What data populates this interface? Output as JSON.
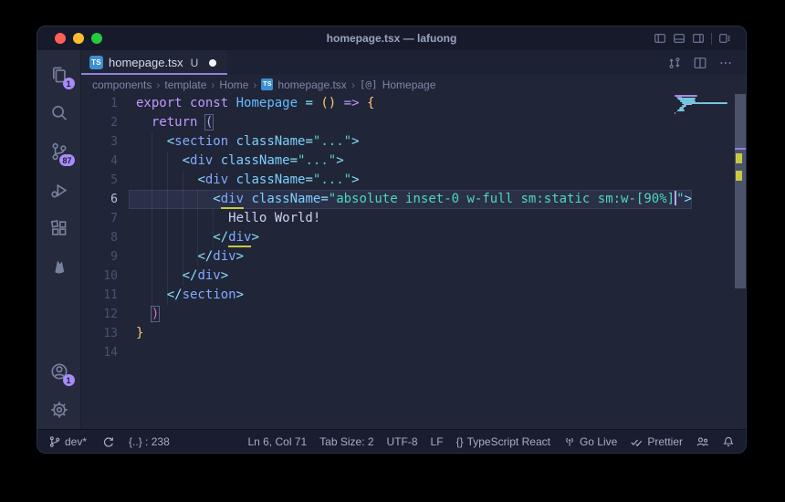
{
  "window": {
    "title": "homepage.tsx — lafuong"
  },
  "tab": {
    "file": "homepage.tsx",
    "git": "U",
    "ts_badge": "TS"
  },
  "breadcrumb": {
    "separator": "›",
    "symbol_glyph": "[@]",
    "items": [
      "components",
      "template",
      "Home",
      "homepage.tsx",
      "Homepage"
    ]
  },
  "activity_bar": {
    "explorer_badge": "1",
    "scm_badge": "87",
    "accounts_badge": "1"
  },
  "status_bar": {
    "branch": "dev*",
    "counter": "{..} : 238",
    "line_col": "Ln 6, Col 71",
    "tab_size": "Tab Size: 2",
    "encoding": "UTF-8",
    "eol": "LF",
    "language_icon": "{}",
    "language": "TypeScript React",
    "go_live": "Go Live",
    "prettier": "Prettier"
  },
  "code": {
    "lines": [
      {
        "n": 1,
        "tokens": [
          {
            "t": "export",
            "c": "kw"
          },
          {
            "t": " ",
            "c": "fg"
          },
          {
            "t": "const",
            "c": "kw"
          },
          {
            "t": " ",
            "c": "fg"
          },
          {
            "t": "Homepage",
            "c": "comp"
          },
          {
            "t": " ",
            "c": "fg"
          },
          {
            "t": "=",
            "c": "punct"
          },
          {
            "t": " ",
            "c": "fg"
          },
          {
            "t": "()",
            "c": "ybr"
          },
          {
            "t": " ",
            "c": "fg"
          },
          {
            "t": "=>",
            "c": "kw"
          },
          {
            "t": " ",
            "c": "fg"
          },
          {
            "t": "{",
            "c": "ybr"
          }
        ]
      },
      {
        "n": 2,
        "tokens": [
          {
            "t": "  ",
            "c": "fg"
          },
          {
            "t": "return",
            "c": "kw"
          },
          {
            "t": " ",
            "c": "fg"
          },
          {
            "t": "(",
            "c": "lav",
            "box": true
          }
        ]
      },
      {
        "n": 3,
        "tokens": [
          {
            "t": "    ",
            "c": "fg"
          },
          {
            "t": "<",
            "c": "punct"
          },
          {
            "t": "section",
            "c": "tag"
          },
          {
            "t": " ",
            "c": "fg"
          },
          {
            "t": "className",
            "c": "attr"
          },
          {
            "t": "=",
            "c": "punct"
          },
          {
            "t": "\"...\"",
            "c": "str"
          },
          {
            "t": ">",
            "c": "punct"
          }
        ]
      },
      {
        "n": 4,
        "tokens": [
          {
            "t": "      ",
            "c": "fg"
          },
          {
            "t": "<",
            "c": "punct"
          },
          {
            "t": "div",
            "c": "tag"
          },
          {
            "t": " ",
            "c": "fg"
          },
          {
            "t": "className",
            "c": "attr"
          },
          {
            "t": "=",
            "c": "punct"
          },
          {
            "t": "\"...\"",
            "c": "str"
          },
          {
            "t": ">",
            "c": "punct"
          }
        ]
      },
      {
        "n": 5,
        "tokens": [
          {
            "t": "        ",
            "c": "fg"
          },
          {
            "t": "<",
            "c": "punct"
          },
          {
            "t": "div",
            "c": "tag"
          },
          {
            "t": " ",
            "c": "fg"
          },
          {
            "t": "className",
            "c": "attr"
          },
          {
            "t": "=",
            "c": "punct"
          },
          {
            "t": "\"...\"",
            "c": "str"
          },
          {
            "t": ">",
            "c": "punct"
          }
        ]
      },
      {
        "n": 6,
        "current": true,
        "tokens": [
          {
            "t": "          ",
            "c": "fg"
          },
          {
            "t": "<",
            "c": "punct"
          },
          {
            "t": "div",
            "c": "tag",
            "u": true
          },
          {
            "t": " ",
            "c": "fg"
          },
          {
            "t": "className",
            "c": "attr"
          },
          {
            "t": "=",
            "c": "punct"
          },
          {
            "t": "\"absolute inset-0 w-full sm:static sm:w-[90%]",
            "c": "str"
          },
          {
            "t": "",
            "cursor": true
          },
          {
            "t": "\"",
            "c": "str"
          },
          {
            "t": ">",
            "c": "punct"
          }
        ]
      },
      {
        "n": 7,
        "tokens": [
          {
            "t": "            Hello World!",
            "c": "fg"
          }
        ]
      },
      {
        "n": 8,
        "tokens": [
          {
            "t": "          ",
            "c": "fg"
          },
          {
            "t": "</",
            "c": "punct"
          },
          {
            "t": "div",
            "c": "tag",
            "u": true
          },
          {
            "t": ">",
            "c": "punct"
          }
        ]
      },
      {
        "n": 9,
        "tokens": [
          {
            "t": "        ",
            "c": "fg"
          },
          {
            "t": "</",
            "c": "punct"
          },
          {
            "t": "div",
            "c": "tag"
          },
          {
            "t": ">",
            "c": "punct"
          }
        ]
      },
      {
        "n": 10,
        "tokens": [
          {
            "t": "      ",
            "c": "fg"
          },
          {
            "t": "</",
            "c": "punct"
          },
          {
            "t": "div",
            "c": "tag"
          },
          {
            "t": ">",
            "c": "punct"
          }
        ]
      },
      {
        "n": 11,
        "tokens": [
          {
            "t": "    ",
            "c": "fg"
          },
          {
            "t": "</",
            "c": "punct"
          },
          {
            "t": "section",
            "c": "tag"
          },
          {
            "t": ">",
            "c": "punct"
          }
        ]
      },
      {
        "n": 12,
        "tokens": [
          {
            "t": "  ",
            "c": "fg"
          },
          {
            "t": ")",
            "c": "pink",
            "box": true
          }
        ]
      },
      {
        "n": 13,
        "tokens": [
          {
            "t": "}",
            "c": "ybr"
          }
        ]
      },
      {
        "n": 14,
        "tokens": []
      }
    ]
  }
}
